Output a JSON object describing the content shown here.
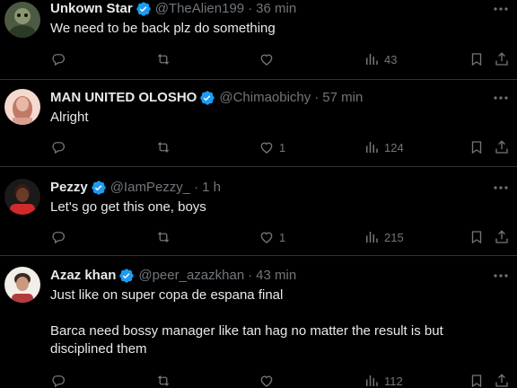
{
  "tweets": [
    {
      "name": "Unkown Star",
      "handle": "@TheAlien199",
      "dot": "·",
      "time": "36 min",
      "text": [
        "We need to be back plz do something"
      ],
      "likes": "",
      "views": "43",
      "avatar_colors": [
        "#6b7a5a",
        "#2b3a25"
      ]
    },
    {
      "name": "MAN UNITED OLOSHO",
      "handle": "@Chimaobichy",
      "dot": "·",
      "time": "57 min",
      "text": [
        "Alright"
      ],
      "likes": "1",
      "views": "124",
      "avatar_colors": [
        "#e9b7a8",
        "#c07a66"
      ]
    },
    {
      "name": "Pezzy",
      "handle": "@IamPezzy_",
      "dot": "·",
      "time": "1 h",
      "text": [
        "Let's go get this one, boys"
      ],
      "likes": "1",
      "views": "215",
      "avatar_colors": [
        "#3a1a12",
        "#d12a2a"
      ]
    },
    {
      "name": "Azaz khan",
      "handle": "@peer_azazkhan",
      "dot": "·",
      "time": "43 min",
      "text": [
        "Just like on super copa de espana final",
        "Barca need bossy manager like tan hag no matter the result is but disciplined them"
      ],
      "likes": "",
      "views": "112",
      "avatar_colors": [
        "#f2efe8",
        "#3b2a22"
      ]
    }
  ],
  "colors": {
    "background": "#000000",
    "text": "#e7e9ea",
    "muted": "#71767b",
    "verified": "#1d9bf0",
    "divider": "#2f3336"
  },
  "icons": [
    "verified-badge-icon",
    "more-icon",
    "reply-icon",
    "retweet-icon",
    "like-icon",
    "views-icon",
    "bookmark-icon",
    "share-icon"
  ]
}
